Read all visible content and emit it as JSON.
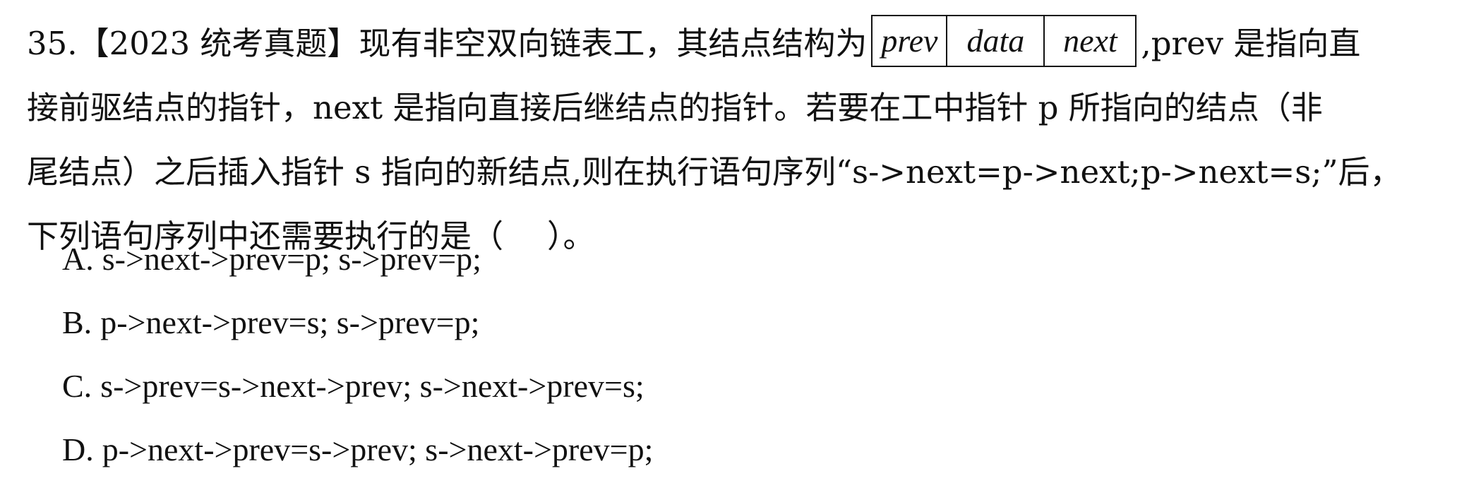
{
  "question": {
    "line1_before_box": "35.【2023 统考真题】现有非空双向链表工，其结点结构为",
    "node_fields": [
      "prev",
      "data",
      "next"
    ],
    "line1_after_box": ",prev 是指向直",
    "line2": "接前驱结点的指针，next 是指向直接后继结点的指针。若要在工中指针 p 所指向的结点（非",
    "line3": "尾结点）之后插入指针 s 指向的新结点,则在执行语句序列“s->next=p->next;p->next=s;”后，",
    "line4_before_blank": "下列语句序列中还需要执行的是（",
    "line4_after_blank": "）。"
  },
  "options": [
    {
      "letter": "A.",
      "text": "s->next->prev=p; s->prev=p;"
    },
    {
      "letter": "B.",
      "text": "p->next->prev=s; s->prev=p;"
    },
    {
      "letter": "C.",
      "text": "s->prev=s->next->prev; s->next->prev=s;"
    },
    {
      "letter": "D.",
      "text": "p->next->prev=s->prev; s->next->prev=p;"
    }
  ]
}
